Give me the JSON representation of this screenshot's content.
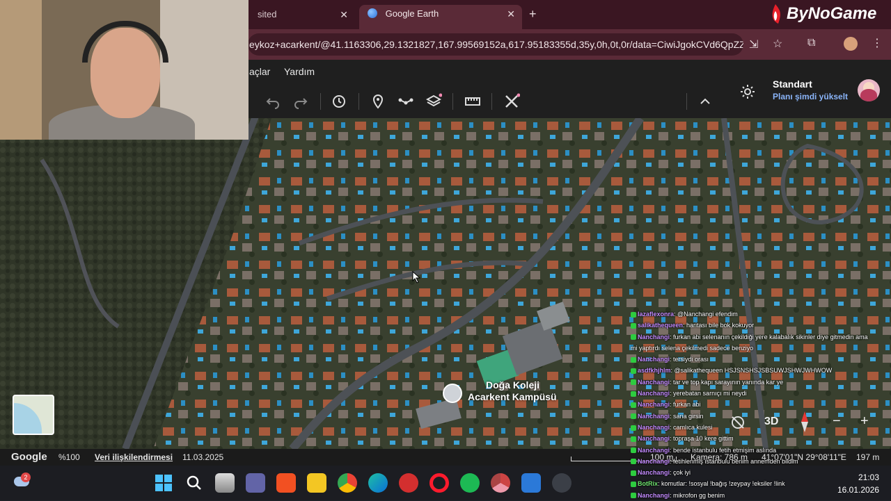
{
  "browser": {
    "tabs": [
      {
        "label": "sited",
        "close_icon": "close-icon"
      },
      {
        "label": "Google Earth",
        "close_icon": "close-icon"
      }
    ],
    "new_tab": "+",
    "address": "eykoz+acarkent/@41.1163306,29.1321827,167.99569152a,617.95183355d,35y,0h,0t,0r/data=CiwiJgokCVd6QpZZ..."
  },
  "watermark": "ByNoGame",
  "earth": {
    "menu": [
      "açlar",
      "Yardım"
    ],
    "account": {
      "plan": "Standart",
      "upgrade_link": "Planı şimdi yükselt"
    },
    "toolbar_icons": [
      "undo-icon",
      "redo-icon",
      "history-icon",
      "placemark-icon",
      "path-icon",
      "layers-icon",
      "ruler-icon",
      "tools-icon",
      "collapse-icon"
    ],
    "poi": {
      "line1": "Doğa Koleji",
      "line2": "Acarkent Kampüsü"
    },
    "map_controls": {
      "mode_3d": "3D",
      "zoom_out": "−",
      "zoom_in": "+"
    },
    "status": {
      "brand": "Google",
      "zoom": "%100",
      "data_attribution": "Veri ilişkilendirmesi",
      "date": "11.03.2025",
      "scale": "100 m",
      "camera": "Kamera: 786 m",
      "coords": "41°07'01\"N 29°08'11\"E",
      "altitude": "197 m"
    }
  },
  "chat": [
    {
      "user": "lazaflexonra",
      "text": "@Nanchangi efendim"
    },
    {
      "user": "salikathequeen",
      "text": "haritası bile bok kokuyor"
    },
    {
      "user": "Nanchangi",
      "text": "furkan abi selenanın çekildiği yere kalabalık sikinler diye gitmedin ama"
    },
    {
      "user": "",
      "text": "mi yaptırdı selena çekilmedi sadece benziyo"
    },
    {
      "user": "Nanchangi",
      "text": "tersiydi orası"
    },
    {
      "user": "asdfkhjhlm",
      "text": "@salikathequeen HSJSNSHSJSBSUWJSHWJWHWOW"
    },
    {
      "user": "Nanchangi",
      "text": "tar ve top kapı sarayının yanında kar ye"
    },
    {
      "user": "Nanchangi",
      "text": "yerebatan sarnıçı mi neydi"
    },
    {
      "user": "Nanchangi",
      "text": "furkan abi"
    },
    {
      "user": "Nanchangi",
      "text": "sana girsin"
    },
    {
      "user": "Nanchangi",
      "text": "camlıca kulesi"
    },
    {
      "user": "Nanchangi",
      "text": "topraşa 10 kere gittim"
    },
    {
      "user": "Nanchangi",
      "text": "bende istanbulu fetih etmişim aslında"
    },
    {
      "user": "Nanchangi",
      "text": "fetihlenmiş istanbulu benim annemden bildim"
    },
    {
      "user": "Nanchangi",
      "text": "çok iyi"
    },
    {
      "user": "BotRix",
      "text": "komutlar: !sosyal !bağış !zeypay !eksiler !link"
    },
    {
      "user": "Nanchangi",
      "text": "mikrofon gg benim"
    }
  ],
  "taskbar": {
    "notification_count": "2",
    "time": "21:03",
    "date": "16.01.2026"
  }
}
